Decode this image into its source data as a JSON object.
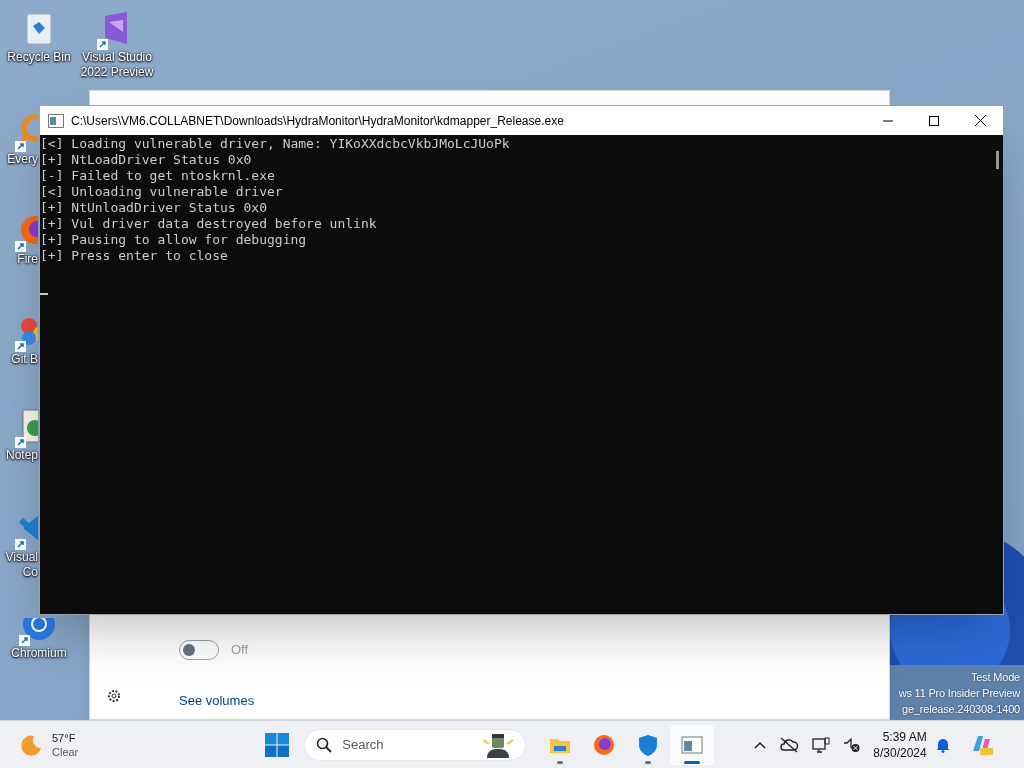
{
  "desktop_icons": [
    {
      "label": "Recycle Bin",
      "kind": "recycle",
      "shortcut": false
    },
    {
      "label": "Visual Studio 2022 Preview",
      "kind": "vs",
      "shortcut": true
    },
    {
      "label": "Every",
      "kind": "everything",
      "shortcut": true
    },
    {
      "label": "Fire",
      "kind": "firefox",
      "shortcut": true
    },
    {
      "label": "Git B",
      "kind": "git",
      "shortcut": true
    },
    {
      "label": "Notep",
      "kind": "notepad",
      "shortcut": true
    },
    {
      "label": "Visual\nCo",
      "kind": "vscode",
      "shortcut": true
    },
    {
      "label": "Chromium",
      "kind": "chromium",
      "shortcut": true
    }
  ],
  "watermark": [
    "Test Mode",
    "ws 11 Pro Insider Preview",
    "ge_release.240308-1400"
  ],
  "security_window": {
    "toggle": {
      "on": false,
      "label": "Off"
    },
    "link": "See volumes"
  },
  "console": {
    "title": "C:\\Users\\VM6.COLLABNET\\Downloads\\HydraMonitor\\HydraMonitor\\kdmapper_Release.exe",
    "lines": [
      "[<] Loading vulnerable driver, Name: YIKoXXdcbcVkbJMoLcJUoPk",
      "[+] NtLoadDriver Status 0x0",
      "[-] Failed to get ntoskrnl.exe",
      "[<] Unloading vulnerable driver",
      "[+] NtUnloadDriver Status 0x0",
      "[+] Vul driver data destroyed before unlink",
      "[+] Pausing to allow for debugging",
      "[+] Press enter to close"
    ]
  },
  "taskbar": {
    "weather": {
      "temp": "57°F",
      "condition": "Clear"
    },
    "search": {
      "placeholder": "Search"
    },
    "apps": [
      {
        "kind": "explorer",
        "running": true,
        "active": false
      },
      {
        "kind": "firefox",
        "running": false,
        "active": false
      },
      {
        "kind": "shield",
        "running": true,
        "active": false
      },
      {
        "kind": "console",
        "running": true,
        "active": true
      }
    ],
    "time": "5:39 AM",
    "date": "8/30/2024"
  }
}
